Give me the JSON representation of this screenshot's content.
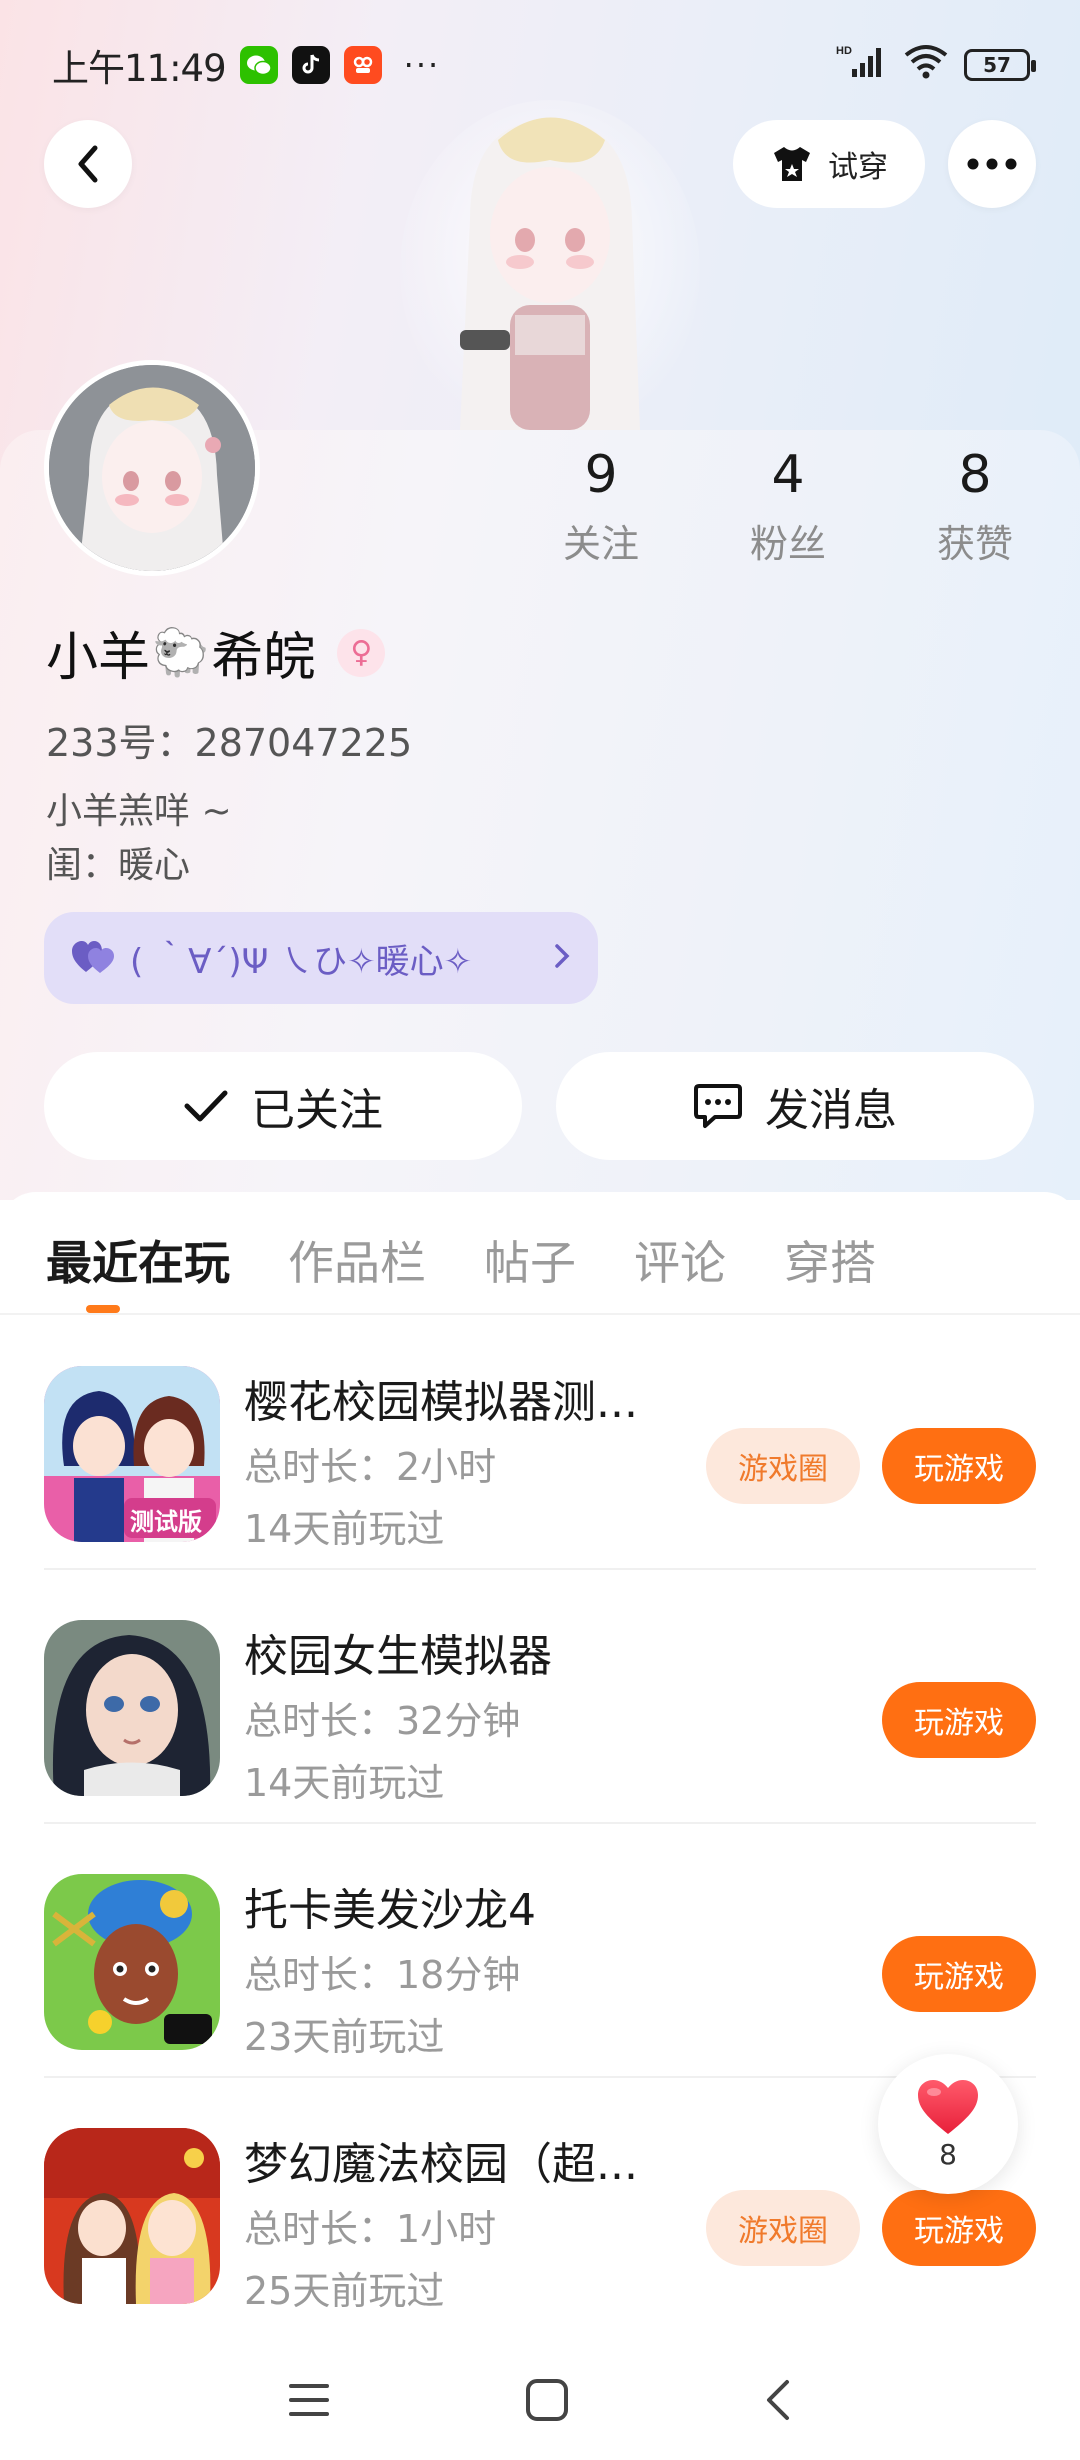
{
  "status_bar": {
    "time": "上午11:49",
    "more": "···",
    "battery": "57",
    "network_label": "HD"
  },
  "header": {
    "tryon_label": "试穿"
  },
  "profile": {
    "stats": [
      {
        "value": "9",
        "label": "关注"
      },
      {
        "value": "4",
        "label": "粉丝"
      },
      {
        "value": "8",
        "label": "获赞"
      }
    ],
    "name_part1": "小羊",
    "name_emoji": "🐑",
    "name_part2": "希皖",
    "gender_symbol": "♀",
    "user_id": "233号：287047225",
    "bio_line1": "小羊羔咩 ~",
    "bio_line2": "闺：暖心",
    "bff_text": "( ｀∀´)Ψ  ㇏ひ✧暖心✧",
    "follow_label": "已关注",
    "message_label": "发消息"
  },
  "tabs": [
    {
      "label": "最近在玩",
      "active": true
    },
    {
      "label": "作品栏",
      "active": false
    },
    {
      "label": "帖子",
      "active": false
    },
    {
      "label": "评论",
      "active": false
    },
    {
      "label": "穿搭",
      "active": false
    }
  ],
  "games": [
    {
      "title": "樱花校园模拟器测...",
      "duration": "总时长：2小时",
      "last_played": "14天前玩过",
      "has_circle": true,
      "circle_label": "游戏圈",
      "play_label": "玩游戏",
      "icon_badge": "测试版"
    },
    {
      "title": "校园女生模拟器",
      "duration": "总时长：32分钟",
      "last_played": "14天前玩过",
      "has_circle": false,
      "play_label": "玩游戏"
    },
    {
      "title": "托卡美发沙龙4",
      "duration": "总时长：18分钟",
      "last_played": "23天前玩过",
      "has_circle": false,
      "play_label": "玩游戏"
    },
    {
      "title": "梦幻魔法校园（超...",
      "duration": "总时长：1小时",
      "last_played": "25天前玩过",
      "has_circle": true,
      "circle_label": "游戏圈",
      "play_label": "玩游戏"
    }
  ],
  "like_float": {
    "count": "8"
  },
  "colors": {
    "accent": "#ff6f12",
    "circle_bg": "#fde8dc",
    "bff_bg": "#e2def8",
    "bff_text": "#6b5dc4"
  }
}
